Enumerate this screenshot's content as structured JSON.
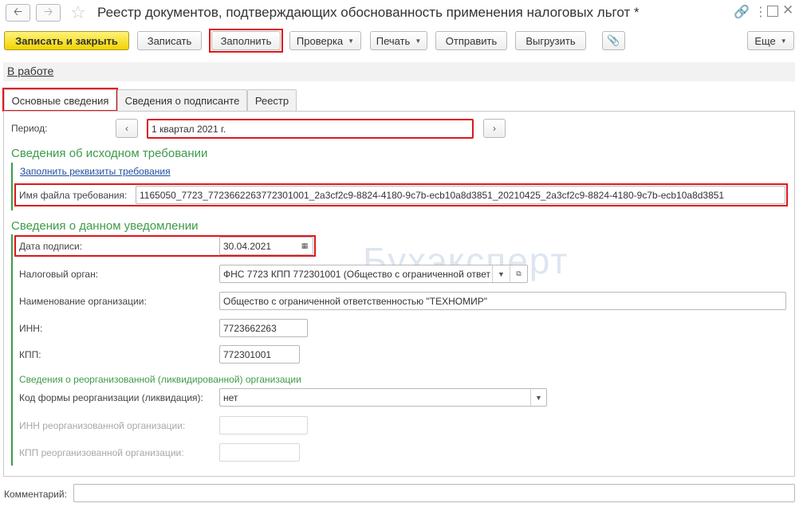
{
  "window": {
    "title": "Реестр документов, подтверждающих обоснованность применения налоговых льгот *",
    "back_icon": "arrow-left-icon",
    "forward_icon": "arrow-right-icon",
    "favorite_icon": "star-icon",
    "link_icon": "link-icon",
    "menu_icon": "more-vertical-icon",
    "maximize_icon": "maximize-icon",
    "close_icon": "close-icon"
  },
  "toolbar": {
    "save_close": "Записать и закрыть",
    "save": "Записать",
    "fill": "Заполнить",
    "check": "Проверка",
    "print": "Печать",
    "send": "Отправить",
    "export": "Выгрузить",
    "attach_icon": "paperclip-icon",
    "more": "Еще"
  },
  "status_link": "В работе",
  "tabs": [
    "Основные сведения",
    "Сведения о подписанте",
    "Реестр"
  ],
  "period": {
    "label": "Период:",
    "value": "1 квартал 2021 г."
  },
  "requirement": {
    "title": "Сведения об исходном требовании",
    "fill_link": "Заполнить реквизиты требования",
    "file_label": "Имя файла требования:",
    "file_value": "1165050_7723_772366226377230100​1_2a3cf2c9-8824-4180-9c7b-ecb10a8d3851_20210425_2a3cf2c9-8824-4180-9c7b-ecb10a8d3851"
  },
  "notice": {
    "title": "Сведения о данном уведомлении",
    "sign_date_label": "Дата подписи:",
    "sign_date_value": "30.04.2021",
    "tax_office_label": "Налоговый орган:",
    "tax_office_value": "ФНС 7723 КПП 772301001 (Общество с ограниченной ответ",
    "org_name_label": "Наименование организации:",
    "org_name_value": "Общество с ограниченной ответственностью \"ТЕХНОМИР\"",
    "inn_label": "ИНН:",
    "inn_value": "7723662263",
    "kpp_label": "КПП:",
    "kpp_value": "772301001"
  },
  "reorg": {
    "title": "Сведения о реорганизованной (ликвидированной) организации",
    "form_code_label": "Код формы реорганизации (ликвидация):",
    "form_code_value": "нет",
    "inn_label": "ИНН реорганизованной организации:",
    "inn_value": "",
    "kpp_label": "КПП реорганизованной организации:",
    "kpp_value": ""
  },
  "comment": {
    "label": "Комментарий:",
    "value": ""
  },
  "watermark": "Бухэксперт",
  "colors": {
    "accent_green": "#3d9b4a",
    "highlight_red": "#e0161b",
    "primary_button": "#f2d400"
  }
}
